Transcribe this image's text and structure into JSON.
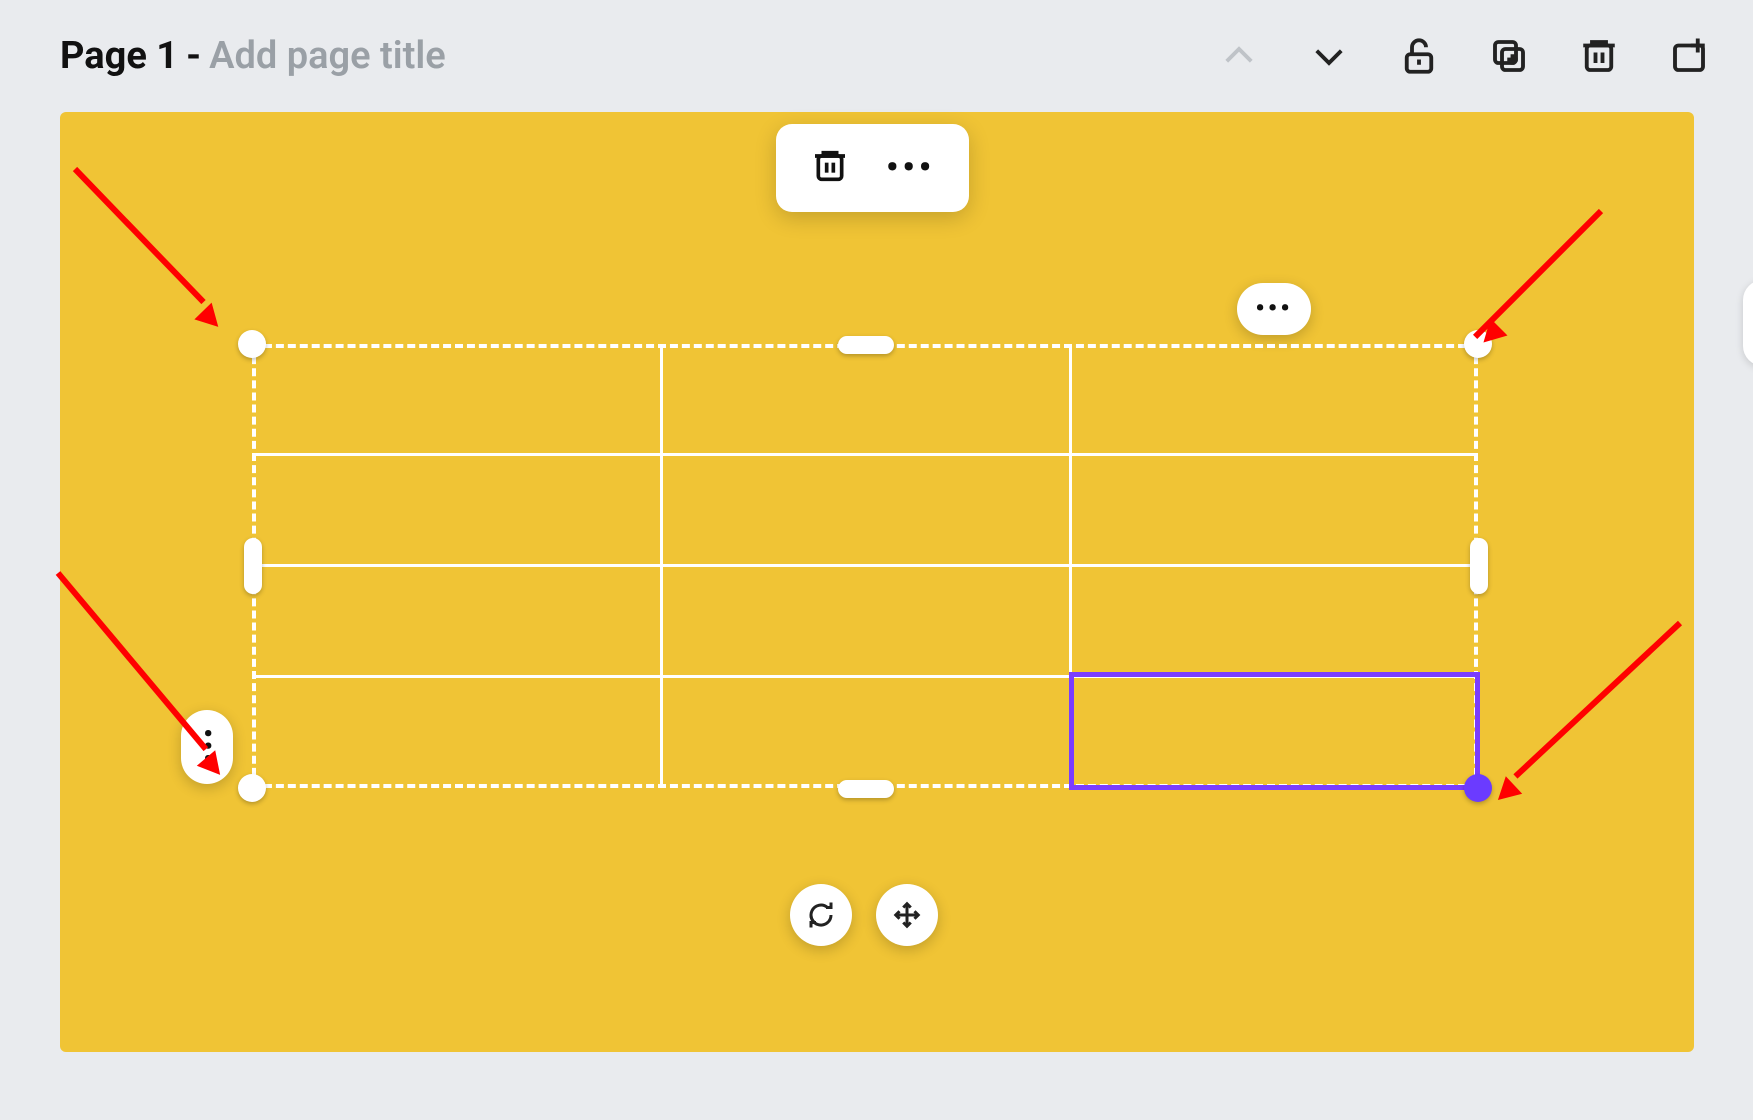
{
  "header": {
    "page_label": "Page 1",
    "separator": "-",
    "title_placeholder": "Add page title"
  },
  "header_icons": {
    "prev": "chevron-up",
    "next": "chevron-down",
    "lock": "unlock",
    "duplicate": "duplicate",
    "delete": "trash",
    "add_page": "add-page"
  },
  "floating_toolbar": {
    "delete": "trash",
    "more": "•••"
  },
  "context_pill_tr": "•••",
  "context_pill_left": "⋮",
  "bottom_controls": {
    "rotate": "rotate",
    "move": "move"
  },
  "colors": {
    "canvas_bg": "#f0c435",
    "selection_border": "#7b3dff",
    "annotation_arrow": "#ff0000",
    "handle_active": "#6b3bff"
  },
  "table": {
    "rows": 4,
    "cols": 3,
    "selected_cell": {
      "row": 3,
      "col": 2
    }
  },
  "annotation_arrows": 4
}
